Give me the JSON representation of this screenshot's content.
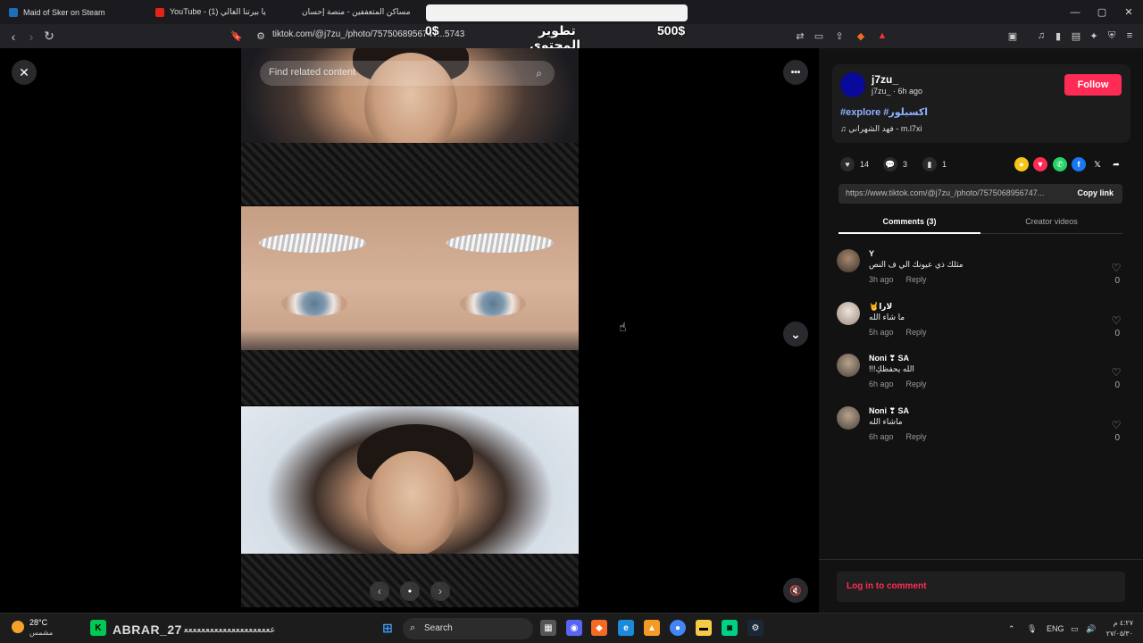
{
  "browser": {
    "tabs": [
      {
        "title": "Maid of Sker on Steam"
      },
      {
        "title": "YouTube - (1) يا بيرتنا الغالي"
      },
      {
        "title": "مساكن المتعففين - منصة إحسان"
      }
    ],
    "url": "tiktok.com/@j7zu_/photo/7575068956747...5743",
    "overlay_texts": [
      "0$",
      "500$",
      "تطوير المحتوى والمايك"
    ],
    "window_controls": [
      "minimize-icon",
      "maximize-icon",
      "close-icon"
    ]
  },
  "viewer": {
    "search_placeholder": "Find related content",
    "close_label": "✕",
    "more_label": "•••",
    "down_label": "⌄",
    "mute_label": "🔇",
    "carousel": {
      "prev": "‹",
      "dot": "•",
      "next": "›"
    }
  },
  "post": {
    "author": {
      "username": "j7zu_",
      "subline": "j7zu_ · 6h ago"
    },
    "follow_label": "Follow",
    "tags": "#explore #اكسبلور",
    "music": "♫ فهد الشهراني - m.l7xi",
    "stats": {
      "likes": "14",
      "comments": "3",
      "saves": "1"
    },
    "share_icons": [
      "coin-icon",
      "tiktok-icon",
      "whatsapp-icon",
      "facebook-icon",
      "x-icon",
      "share-arrow-icon"
    ],
    "link": "https://www.tiktok.com/@j7zu_/photo/7575068956747...",
    "copy_link_label": "Copy link",
    "tabs": {
      "comments": "Comments (3)",
      "creator_videos": "Creator videos"
    }
  },
  "comments": [
    {
      "name": "Y",
      "text": "مثلك ذي عيونك الي ف النص",
      "time": "3h ago",
      "reply": "Reply",
      "likes": "0"
    },
    {
      "name": "🤘لارا",
      "text": "ما شاء الله",
      "time": "5h ago",
      "reply": "Reply",
      "likes": "0"
    },
    {
      "name": "Noni ❣ SA",
      "text": "!!!الله يحفظكِ",
      "time": "6h ago",
      "reply": "Reply",
      "likes": "0"
    },
    {
      "name": "Noni ❣ SA",
      "text": "ماشاء الله",
      "time": "6h ago",
      "reply": "Reply",
      "likes": "0"
    }
  ],
  "login_label": "Log in to comment",
  "taskbar": {
    "weather_temp": "28°C",
    "weather_cond": "مشمس",
    "user_tag": "ABRAR_27",
    "user_tag_tail": "ﻋﻌﻌﻌﻌﻌﻌﻌﻌﻌﻌﻌﻌﻌﻌﻌﻌﻌﻌﻌﻌ",
    "search_label": "Search",
    "lang": "ENG",
    "time": "٤:٢٧ م",
    "date": "٢٧/٠٥/٣٠"
  }
}
